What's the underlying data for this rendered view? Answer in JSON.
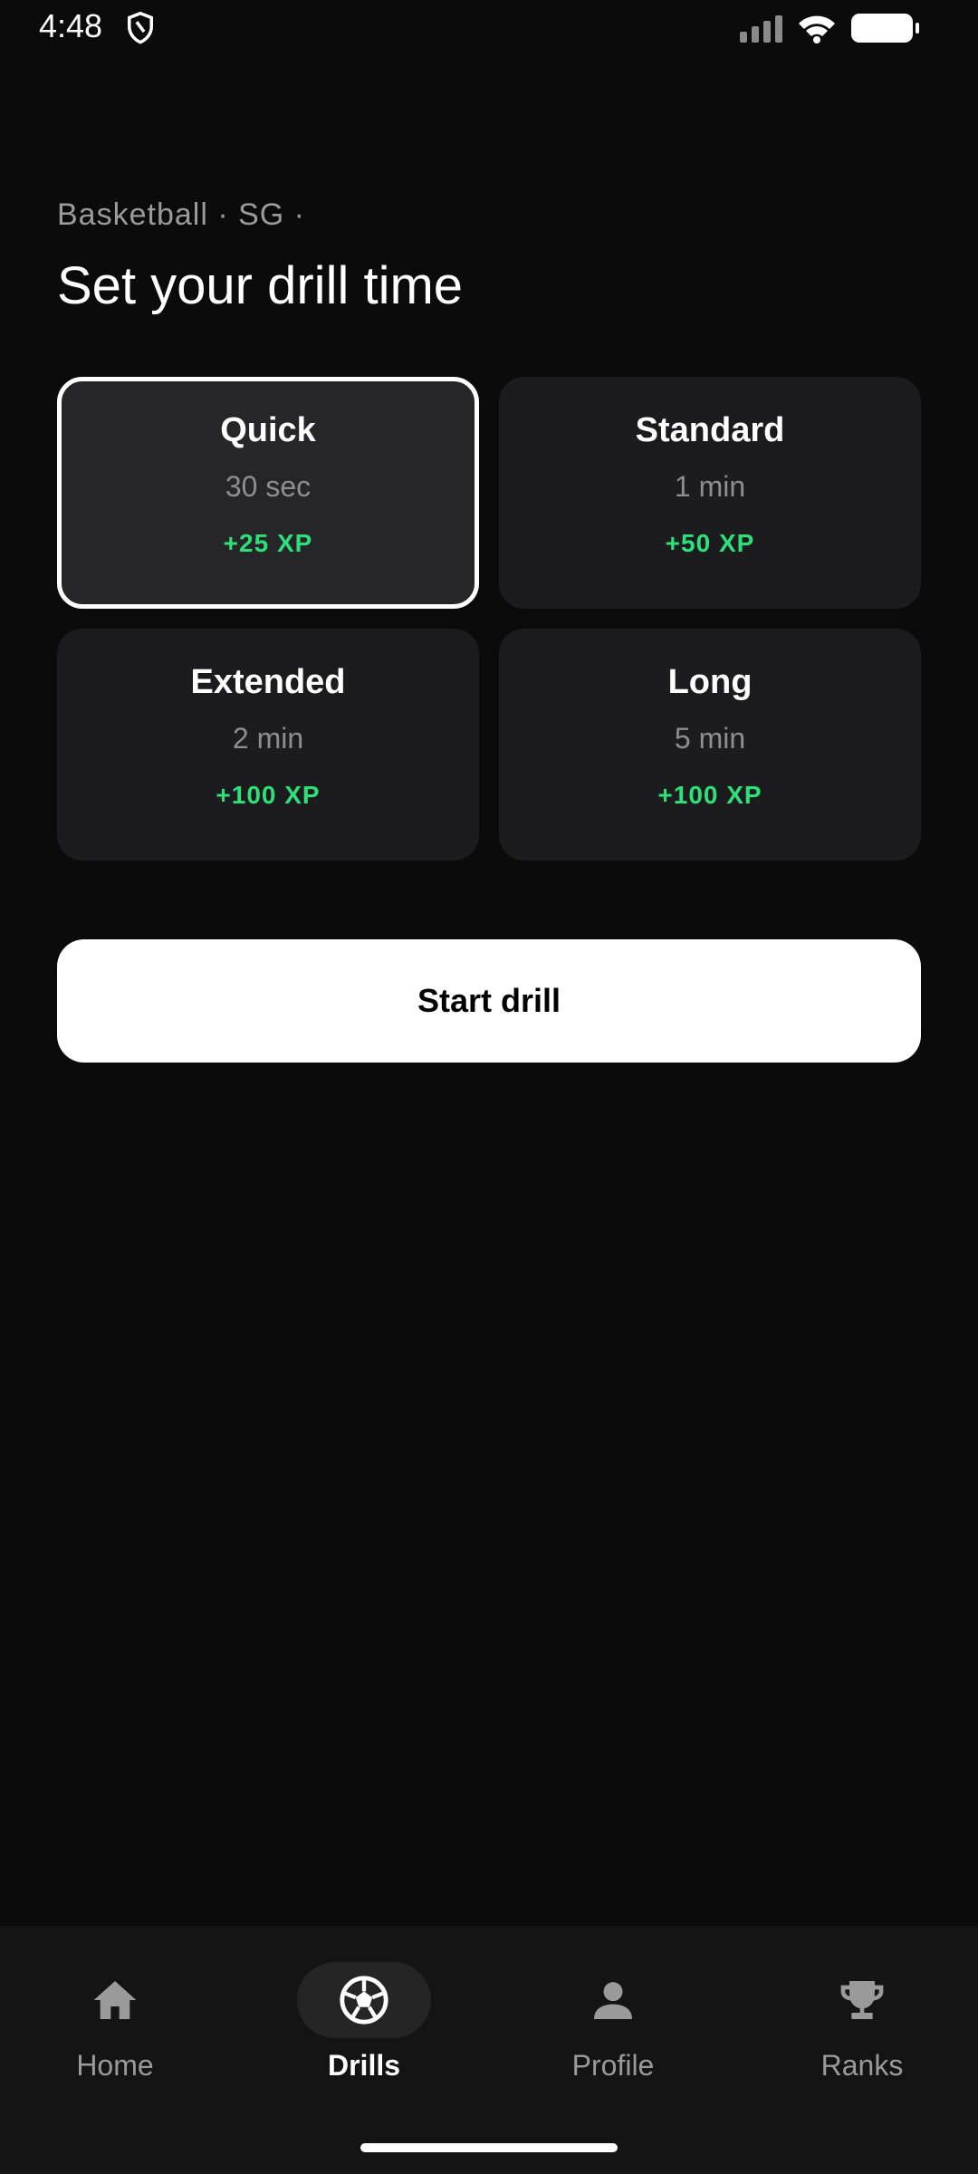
{
  "status_bar": {
    "time": "4:48",
    "icons": [
      "shield-icon",
      "signal-icon",
      "wifi-icon",
      "battery-icon"
    ]
  },
  "header": {
    "subtitle": "Basketball · SG ·",
    "title": "Set your drill time"
  },
  "options": [
    {
      "title": "Quick",
      "duration": "30 sec",
      "xp": "+25 XP",
      "selected": true
    },
    {
      "title": "Standard",
      "duration": "1 min",
      "xp": "+50 XP",
      "selected": false
    },
    {
      "title": "Extended",
      "duration": "2 min",
      "xp": "+100 XP",
      "selected": false
    },
    {
      "title": "Long",
      "duration": "5 min",
      "xp": "+100 XP",
      "selected": false
    }
  ],
  "start_button": {
    "label": "Start drill"
  },
  "nav": {
    "items": [
      {
        "label": "Home",
        "icon": "home-icon",
        "active": false
      },
      {
        "label": "Drills",
        "icon": "ball-icon",
        "active": true
      },
      {
        "label": "Profile",
        "icon": "person-icon",
        "active": false
      },
      {
        "label": "Ranks",
        "icon": "trophy-icon",
        "active": false
      }
    ]
  },
  "colors": {
    "background": "#0b0b0b",
    "card": "#1c1c1e",
    "accent_xp": "#2ee07a",
    "nav_background": "#141414"
  }
}
